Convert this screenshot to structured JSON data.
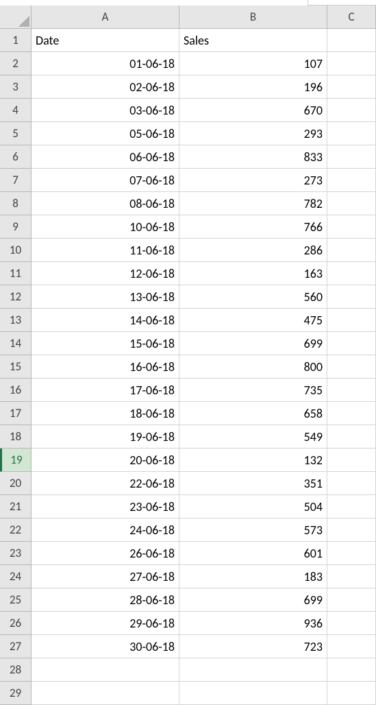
{
  "columns": [
    "A",
    "B",
    "C"
  ],
  "headers": {
    "A": "Date",
    "B": "Sales"
  },
  "active_row": 19,
  "total_visible_rows": 29,
  "rows": [
    {
      "n": 1,
      "A": "Date",
      "B": "Sales",
      "A_align": "txt",
      "B_align": "txt"
    },
    {
      "n": 2,
      "A": "01-06-18",
      "B": "107"
    },
    {
      "n": 3,
      "A": "02-06-18",
      "B": "196"
    },
    {
      "n": 4,
      "A": "03-06-18",
      "B": "670"
    },
    {
      "n": 5,
      "A": "05-06-18",
      "B": "293"
    },
    {
      "n": 6,
      "A": "06-06-18",
      "B": "833"
    },
    {
      "n": 7,
      "A": "07-06-18",
      "B": "273"
    },
    {
      "n": 8,
      "A": "08-06-18",
      "B": "782"
    },
    {
      "n": 9,
      "A": "10-06-18",
      "B": "766"
    },
    {
      "n": 10,
      "A": "11-06-18",
      "B": "286"
    },
    {
      "n": 11,
      "A": "12-06-18",
      "B": "163"
    },
    {
      "n": 12,
      "A": "13-06-18",
      "B": "560"
    },
    {
      "n": 13,
      "A": "14-06-18",
      "B": "475"
    },
    {
      "n": 14,
      "A": "15-06-18",
      "B": "699"
    },
    {
      "n": 15,
      "A": "16-06-18",
      "B": "800"
    },
    {
      "n": 16,
      "A": "17-06-18",
      "B": "735"
    },
    {
      "n": 17,
      "A": "18-06-18",
      "B": "658"
    },
    {
      "n": 18,
      "A": "19-06-18",
      "B": "549"
    },
    {
      "n": 19,
      "A": "20-06-18",
      "B": "132"
    },
    {
      "n": 20,
      "A": "22-06-18",
      "B": "351"
    },
    {
      "n": 21,
      "A": "23-06-18",
      "B": "504"
    },
    {
      "n": 22,
      "A": "24-06-18",
      "B": "573"
    },
    {
      "n": 23,
      "A": "26-06-18",
      "B": "601"
    },
    {
      "n": 24,
      "A": "27-06-18",
      "B": "183"
    },
    {
      "n": 25,
      "A": "28-06-18",
      "B": "699"
    },
    {
      "n": 26,
      "A": "29-06-18",
      "B": "936"
    },
    {
      "n": 27,
      "A": "30-06-18",
      "B": "723"
    },
    {
      "n": 28,
      "A": "",
      "B": ""
    },
    {
      "n": 29,
      "A": "",
      "B": ""
    }
  ],
  "chart_data": {
    "type": "table",
    "title": "",
    "columns": [
      "Date",
      "Sales"
    ],
    "data": [
      [
        "01-06-18",
        107
      ],
      [
        "02-06-18",
        196
      ],
      [
        "03-06-18",
        670
      ],
      [
        "05-06-18",
        293
      ],
      [
        "06-06-18",
        833
      ],
      [
        "07-06-18",
        273
      ],
      [
        "08-06-18",
        782
      ],
      [
        "10-06-18",
        766
      ],
      [
        "11-06-18",
        286
      ],
      [
        "12-06-18",
        163
      ],
      [
        "13-06-18",
        560
      ],
      [
        "14-06-18",
        475
      ],
      [
        "15-06-18",
        699
      ],
      [
        "16-06-18",
        800
      ],
      [
        "17-06-18",
        735
      ],
      [
        "18-06-18",
        658
      ],
      [
        "19-06-18",
        549
      ],
      [
        "20-06-18",
        132
      ],
      [
        "22-06-18",
        351
      ],
      [
        "23-06-18",
        504
      ],
      [
        "24-06-18",
        573
      ],
      [
        "26-06-18",
        601
      ],
      [
        "27-06-18",
        183
      ],
      [
        "28-06-18",
        699
      ],
      [
        "29-06-18",
        936
      ],
      [
        "30-06-18",
        723
      ]
    ]
  }
}
